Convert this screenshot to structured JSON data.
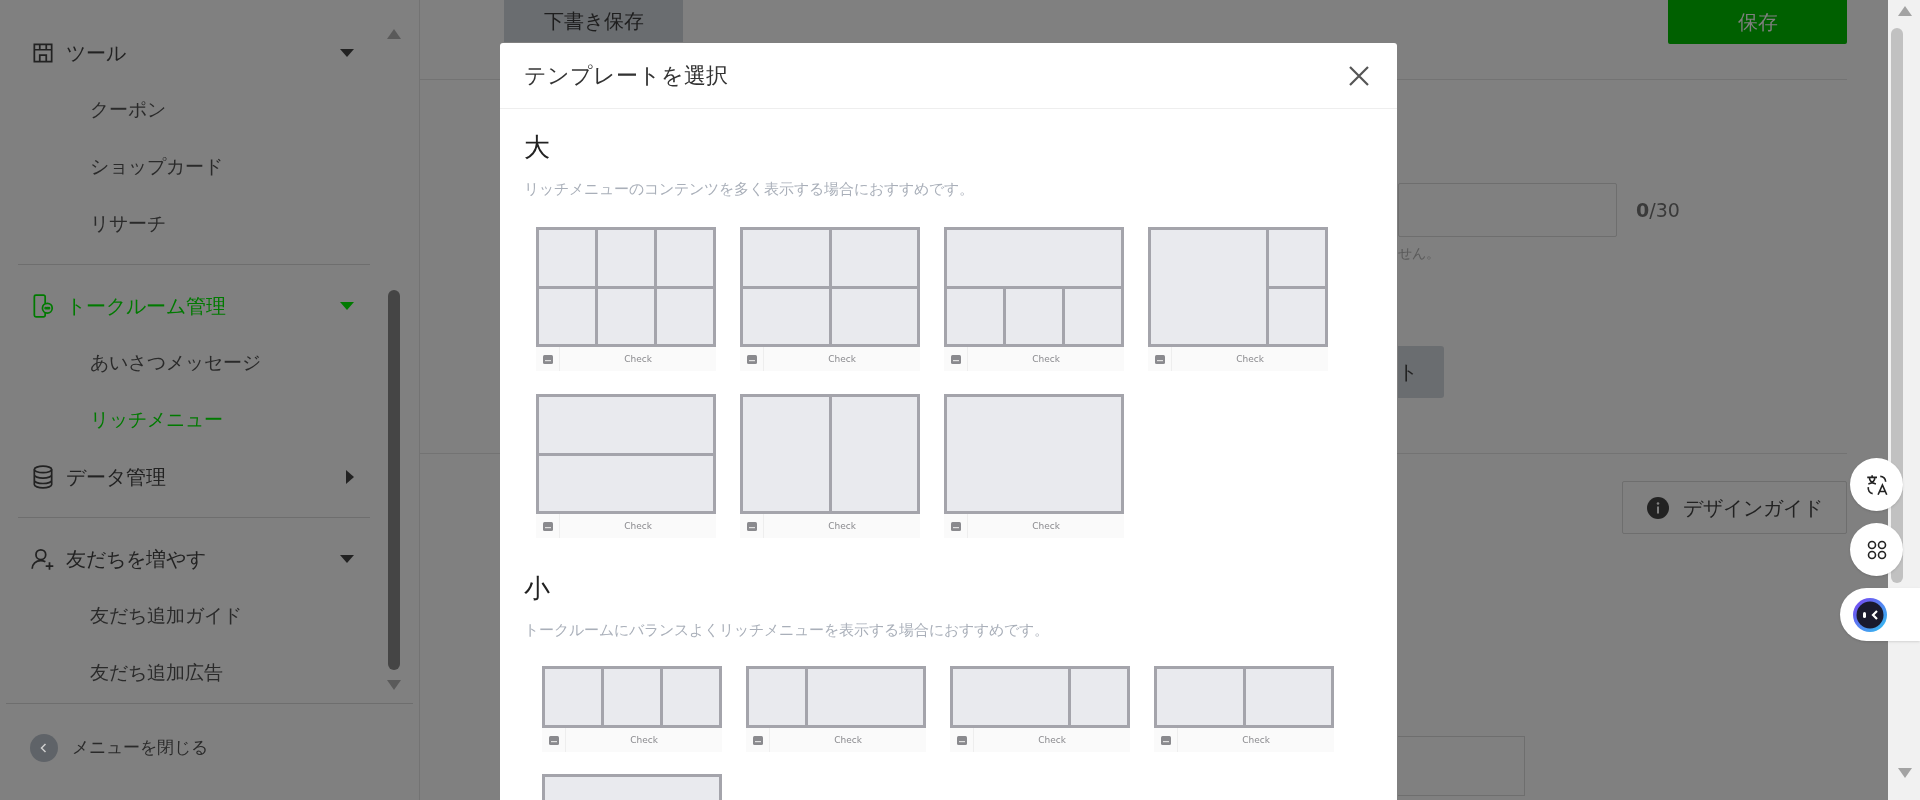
{
  "sidebar": {
    "groups": [
      {
        "label": "ツール",
        "expanded": true,
        "selected": false,
        "divider_before": false,
        "items": [
          {
            "label": "クーポン",
            "selected": false
          },
          {
            "label": "ショップカード",
            "selected": false
          },
          {
            "label": "リサーチ",
            "selected": false
          }
        ]
      },
      {
        "label": "トークルーム管理",
        "expanded": true,
        "selected": true,
        "divider_before": true,
        "items": [
          {
            "label": "あいさつメッセージ",
            "selected": false
          },
          {
            "label": "リッチメニュー",
            "selected": true
          }
        ]
      },
      {
        "label": "データ管理",
        "expanded": false,
        "selected": false,
        "divider_before": false
      },
      {
        "label": "友だちを増やす",
        "expanded": true,
        "selected": false,
        "divider_before": true,
        "items": [
          {
            "label": "友だち追加ガイド",
            "selected": false
          },
          {
            "label": "友だち追加広告",
            "selected": false
          }
        ]
      }
    ],
    "close_label": "メニューを閉じる"
  },
  "background": {
    "draft_button": "下書き保存",
    "save_button": "保存",
    "counter": "**0**/30",
    "note_fragment": "せん。",
    "button_fragment": "ト",
    "design_guide_button": "デザインガイド"
  },
  "modal": {
    "title": "テンプレートを選択",
    "sections": [
      {
        "heading": "大",
        "description": "リッチメニューのコンテンツを多く表示する場合におすすめです。",
        "kind": "large",
        "templates": [
          {
            "kind": "grid6",
            "label": "Check"
          },
          {
            "kind": "grid4",
            "label": "Check"
          },
          {
            "kind": "topthree",
            "label": "Check"
          },
          {
            "kind": "lefttwo",
            "label": "Check"
          },
          {
            "kind": "rows",
            "label": "Check"
          },
          {
            "kind": "halves",
            "label": "Check"
          },
          {
            "kind": "single",
            "label": "Check"
          }
        ]
      },
      {
        "heading": "小",
        "description": "トークルームにバランスよくリッチメニューを表示する場合におすすめです。",
        "kind": "small",
        "templates": [
          {
            "kind": "three",
            "label": "Check"
          },
          {
            "kind": "narrowwide",
            "label": "Check"
          },
          {
            "kind": "widenarrow",
            "label": "Check"
          },
          {
            "kind": "halves",
            "label": "Check"
          },
          {
            "kind": "single"
          }
        ]
      }
    ]
  }
}
